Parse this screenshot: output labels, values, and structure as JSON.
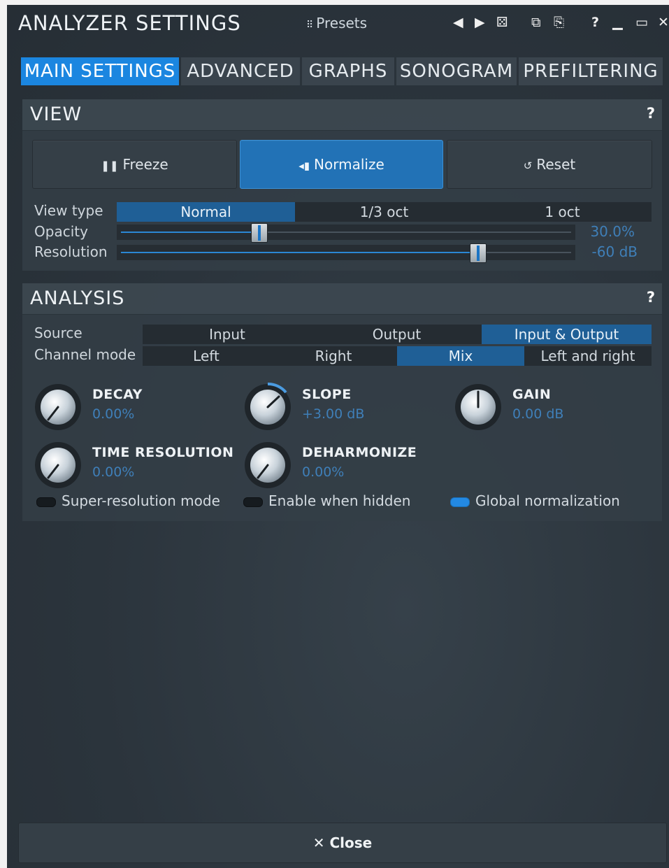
{
  "window": {
    "title": "ANALYZER SETTINGS",
    "presets_label": "Presets"
  },
  "titlebar_icons": [
    "prev-icon",
    "next-icon",
    "random-icon",
    "copy-icon",
    "paste-icon",
    "help-icon",
    "minimize-icon",
    "maximize-icon",
    "close-icon"
  ],
  "titlebar_glyphs": {
    "prev": "◀",
    "next": "▶",
    "random": "⚄",
    "copy": "⧉",
    "paste": "⎘",
    "help": "?",
    "minimize": "▁",
    "maximize": "▭",
    "close": "✕"
  },
  "tabs": [
    {
      "label": "MAIN SETTINGS",
      "active": true
    },
    {
      "label": "ADVANCED",
      "active": false
    },
    {
      "label": "GRAPHS",
      "active": false
    },
    {
      "label": "SONOGRAM",
      "active": false
    },
    {
      "label": "PREFILTERING",
      "active": false
    }
  ],
  "view": {
    "title": "VIEW",
    "help": "?",
    "buttons": {
      "freeze": {
        "label": "Freeze",
        "icon": "❚❚"
      },
      "normalize": {
        "label": "Normalize",
        "icon": "◂▮"
      },
      "reset": {
        "label": "Reset",
        "icon": "↺"
      }
    },
    "view_type": {
      "label": "View type",
      "options": [
        "Normal",
        "1/3 oct",
        "1 oct"
      ],
      "selected": "Normal"
    },
    "opacity": {
      "label": "Opacity",
      "value": "30.0%",
      "fraction": 0.3
    },
    "resolution": {
      "label": "Resolution",
      "value": "-60 dB",
      "fraction": 0.78
    }
  },
  "analysis": {
    "title": "ANALYSIS",
    "help": "?",
    "source": {
      "label": "Source",
      "options": [
        "Input",
        "Output",
        "Input & Output"
      ],
      "selected": "Input & Output"
    },
    "channel_mode": {
      "label": "Channel mode",
      "options": [
        "Left",
        "Right",
        "Mix",
        "Left and right"
      ],
      "selected": "Mix"
    },
    "knobs": {
      "decay": {
        "title": "DECAY",
        "value": "0.00%"
      },
      "slope": {
        "title": "SLOPE",
        "value": "+3.00 dB"
      },
      "gain": {
        "title": "GAIN",
        "value": "0.00 dB"
      },
      "time_resolution": {
        "title": "TIME RESOLUTION",
        "value": "0.00%"
      },
      "deharmonize": {
        "title": "DEHARMONIZE",
        "value": "0.00%"
      }
    },
    "toggles": {
      "super_resolution": {
        "label": "Super-resolution mode",
        "on": false
      },
      "enable_when_hidden": {
        "label": "Enable when hidden",
        "on": false
      },
      "global_normalization": {
        "label": "Global normalization",
        "on": true
      }
    }
  },
  "close_button": {
    "label": "Close",
    "icon": "✕"
  },
  "colors": {
    "accent": "#1b86e0",
    "selected_segment": "#1f5f96",
    "value_text": "#3f7fb8",
    "background": "#2b343c"
  }
}
